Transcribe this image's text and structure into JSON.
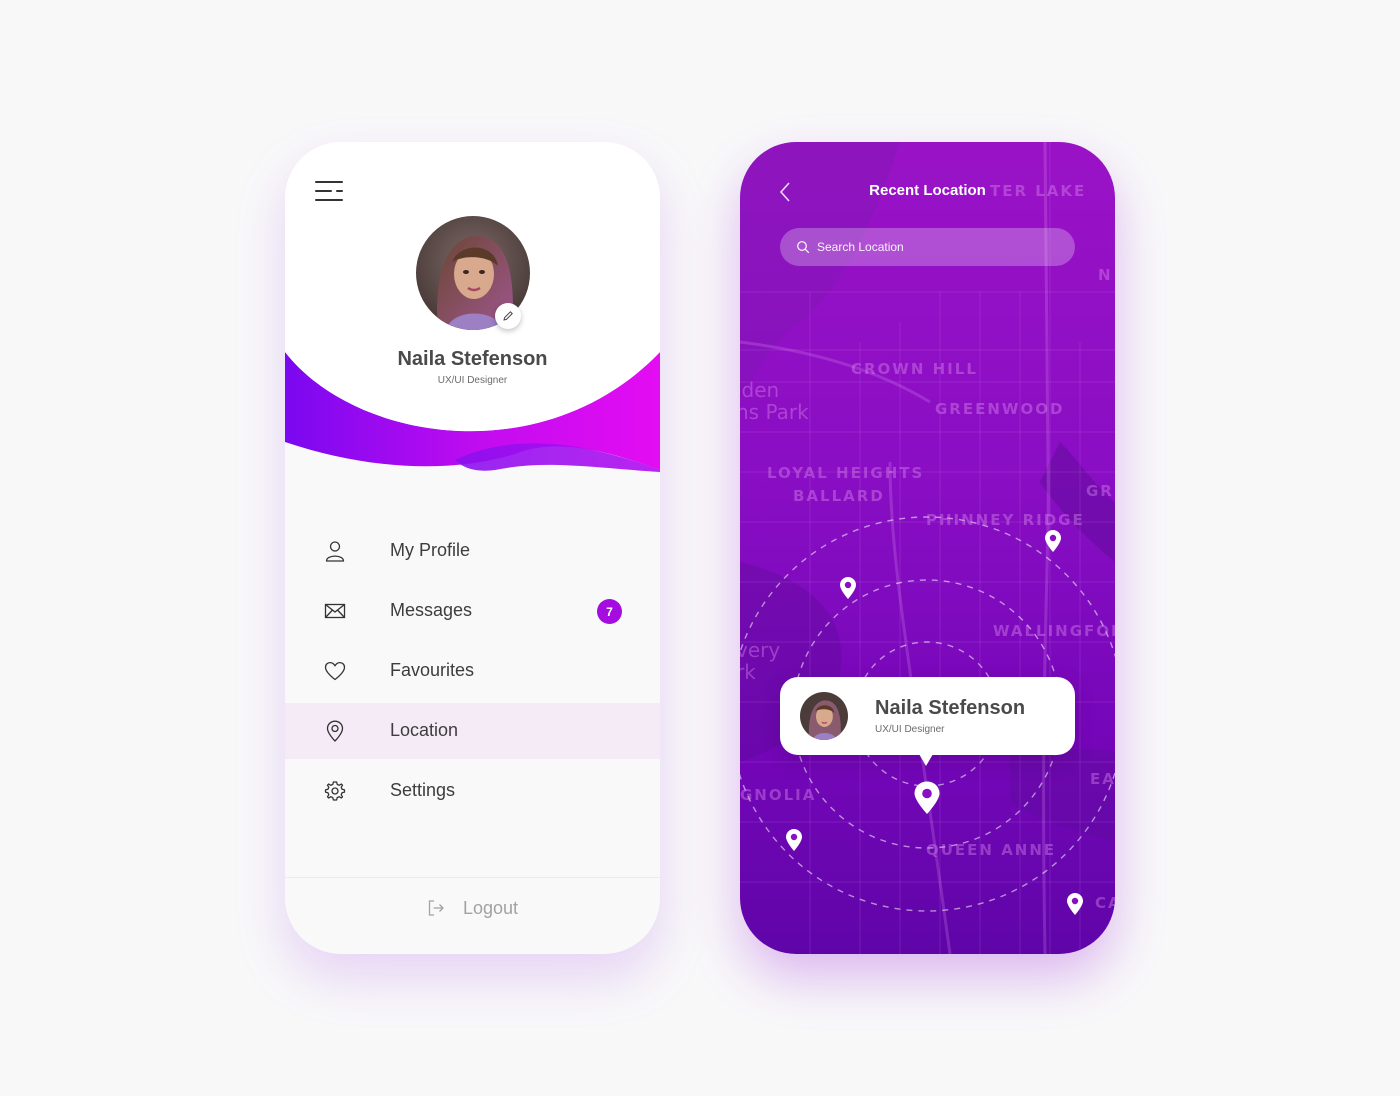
{
  "menu_screen": {
    "profile": {
      "name": "Naila Stefenson",
      "role": "UX/UI Designer"
    },
    "menu_items": [
      {
        "label": "My Profile",
        "icon": "user-icon"
      },
      {
        "label": "Messages",
        "icon": "mail-icon",
        "badge": "7"
      },
      {
        "label": "Favourites",
        "icon": "heart-icon"
      },
      {
        "label": "Location",
        "icon": "location-pin-icon",
        "active": true
      },
      {
        "label": "Settings",
        "icon": "gear-icon"
      }
    ],
    "logout_label": "Logout"
  },
  "map_screen": {
    "title": "Recent Location",
    "search": {
      "placeholder": "Search Location",
      "value": ""
    },
    "map_labels": [
      "TER LAKE",
      "N",
      "CROWN HILL",
      "lden",
      "ns Park",
      "GREENWOOD",
      "LOYAL HEIGHTS",
      "BALLARD",
      "GR",
      "PHINNEY RIDGE",
      "WALLINGFOR",
      "very",
      "rk",
      "EA",
      "GNOLIA",
      "QUEEN ANNE",
      "CA"
    ],
    "location_card": {
      "name": "Naila Stefenson",
      "role": "UX/UI Designer"
    }
  },
  "colors": {
    "accent": "#a50ce0",
    "gradient_pink": "#e40cf2",
    "gradient_purple": "#7a08f0",
    "map_top": "#9a12c6",
    "map_bottom": "#5f05a8"
  }
}
